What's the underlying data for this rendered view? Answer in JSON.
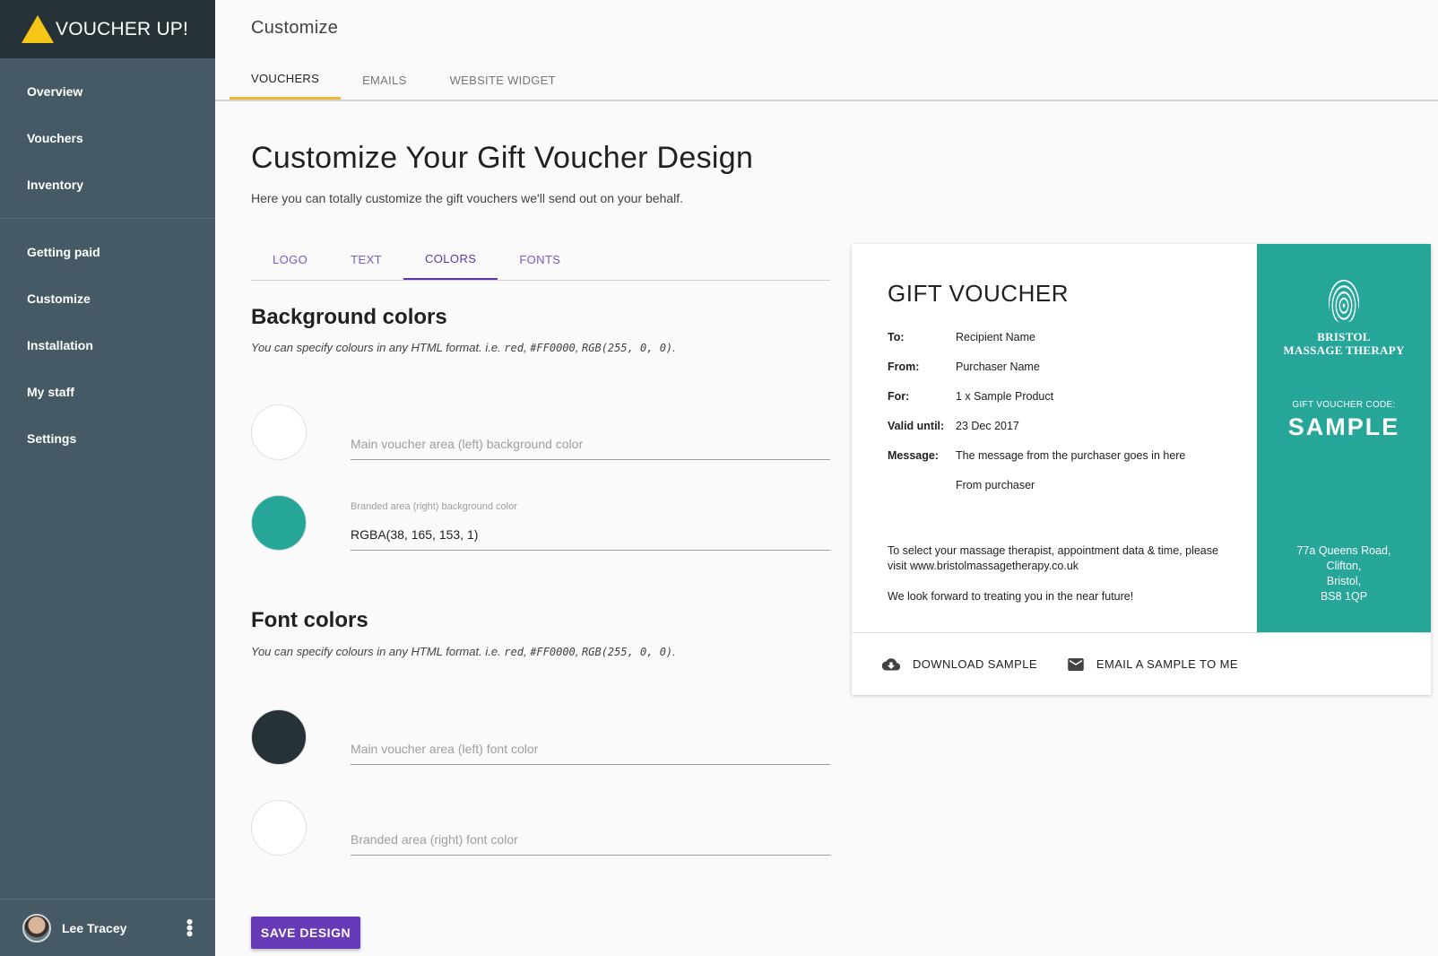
{
  "app": {
    "name": "VOUCHER UP!"
  },
  "sidebar": {
    "groups": [
      [
        {
          "label": "Overview"
        },
        {
          "label": "Vouchers"
        },
        {
          "label": "Inventory"
        }
      ],
      [
        {
          "label": "Getting paid"
        },
        {
          "label": "Customize"
        },
        {
          "label": "Installation"
        },
        {
          "label": "My staff"
        },
        {
          "label": "Settings"
        }
      ]
    ],
    "user": {
      "name": "Lee Tracey",
      "menu_icon": "more-vert-icon"
    }
  },
  "header": {
    "title": "Customize",
    "tabs": [
      {
        "label": "VOUCHERS",
        "active": true
      },
      {
        "label": "EMAILS",
        "active": false
      },
      {
        "label": "WEBSITE WIDGET",
        "active": false
      }
    ]
  },
  "page": {
    "title": "Customize Your Gift Voucher Design",
    "subtitle": "Here you can totally customize the gift vouchers we'll send out on your behalf."
  },
  "subtabs": [
    {
      "label": "LOGO",
      "active": false
    },
    {
      "label": "TEXT",
      "active": false
    },
    {
      "label": "COLORS",
      "active": true
    },
    {
      "label": "FONTS",
      "active": false
    }
  ],
  "background_colors": {
    "title": "Background colors",
    "help_prefix": "You can specify colours in any HTML format. i.e. ",
    "help_code1": "red",
    "help_sep1": ", ",
    "help_code2": "#FF0000",
    "help_sep2": ", ",
    "help_code3": "RGB(255, 0, 0)",
    "help_suffix": ".",
    "fields": [
      {
        "label": "",
        "placeholder": "Main voucher area (left) background color",
        "value": "",
        "swatch": "#ffffff"
      },
      {
        "label": "Branded area (right) background color",
        "placeholder": "",
        "value": "RGBA(38, 165, 153, 1)",
        "swatch": "#26a599"
      }
    ]
  },
  "font_colors": {
    "title": "Font colors",
    "help_prefix": "You can specify colours in any HTML format. i.e. ",
    "help_code1": "red",
    "help_sep1": ", ",
    "help_code2": "#FF0000",
    "help_sep2": ", ",
    "help_code3": "RGB(255, 0, 0)",
    "help_suffix": ".",
    "fields": [
      {
        "label": "",
        "placeholder": "Main voucher area (left) font color",
        "value": "",
        "swatch": "#263238"
      },
      {
        "label": "",
        "placeholder": "Branded area (right) font color",
        "value": "",
        "swatch": "#ffffff"
      }
    ]
  },
  "save_label": "SAVE DESIGN",
  "preview": {
    "title": "GIFT VOUCHER",
    "rows": [
      {
        "key": "To:",
        "value": "Recipient Name"
      },
      {
        "key": "From:",
        "value": "Purchaser Name"
      },
      {
        "key": "For:",
        "value": "1 x Sample Product"
      },
      {
        "key": "Valid until:",
        "value": "23 Dec 2017"
      },
      {
        "key": "Message:",
        "value": "The message from the purchaser goes in here"
      },
      {
        "key": "",
        "value": "From purchaser"
      }
    ],
    "footer_line1": "To select your massage therapist, appointment data & time, please visit www.bristolmassagetherapy.co.uk",
    "footer_line2": "We look forward to treating you in the near future!",
    "brand_line1": "BRISTOL",
    "brand_line2": "MASSAGE THERAPY",
    "code_label": "GIFT VOUCHER CODE:",
    "code": "SAMPLE",
    "address": [
      "77a Queens Road,",
      "Clifton,",
      "Bristol,",
      "BS8 1QP"
    ],
    "actions": [
      {
        "label": "DOWNLOAD SAMPLE",
        "icon": "cloud-download-icon"
      },
      {
        "label": "EMAIL A SAMPLE TO ME",
        "icon": "email-icon"
      }
    ]
  },
  "colors": {
    "sidebar": "#455a64",
    "brand_bar": "#263238",
    "accent_tab": "#f2b632",
    "primary": "#673ab7",
    "teal": "#26a599"
  }
}
